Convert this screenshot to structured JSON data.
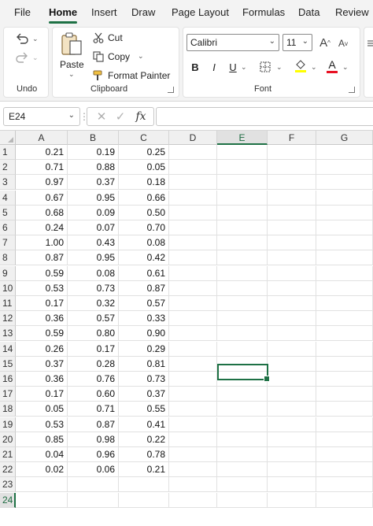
{
  "menu": {
    "items": [
      "File",
      "Home",
      "Insert",
      "Draw",
      "Page Layout",
      "Formulas",
      "Data",
      "Review"
    ],
    "active": "Home"
  },
  "ribbon": {
    "undo_group": "Undo",
    "clipboard_group": "Clipboard",
    "paste_label": "Paste",
    "cut_label": "Cut",
    "copy_label": "Copy",
    "format_painter_label": "Format Painter",
    "font_group": "Font",
    "font_name": "Calibri",
    "font_size": "11",
    "bold": "B",
    "italic": "I",
    "underline": "U",
    "grow_font": "A",
    "shrink_font": "A",
    "font_color_letter": "A",
    "fill_color": "#ffff00",
    "font_color": "#e81123"
  },
  "formula_bar": {
    "name_box": "E24",
    "fx": "fx",
    "value": ""
  },
  "sheet": {
    "columns": [
      "A",
      "B",
      "C",
      "D",
      "E",
      "F",
      "G"
    ],
    "selected_column": "E",
    "rows": [
      "1",
      "2",
      "3",
      "4",
      "5",
      "6",
      "7",
      "8",
      "9",
      "10",
      "11",
      "12",
      "13",
      "14",
      "15",
      "16",
      "17",
      "18",
      "19",
      "20",
      "21",
      "22",
      "23",
      "24"
    ],
    "selected_row": "24",
    "data": [
      [
        "0.21",
        "0.19",
        "0.25"
      ],
      [
        "0.71",
        "0.88",
        "0.05"
      ],
      [
        "0.97",
        "0.37",
        "0.18"
      ],
      [
        "0.67",
        "0.95",
        "0.66"
      ],
      [
        "0.68",
        "0.09",
        "0.50"
      ],
      [
        "0.24",
        "0.07",
        "0.70"
      ],
      [
        "1.00",
        "0.43",
        "0.08"
      ],
      [
        "0.87",
        "0.95",
        "0.42"
      ],
      [
        "0.59",
        "0.08",
        "0.61"
      ],
      [
        "0.53",
        "0.73",
        "0.87"
      ],
      [
        "0.17",
        "0.32",
        "0.57"
      ],
      [
        "0.36",
        "0.57",
        "0.33"
      ],
      [
        "0.59",
        "0.80",
        "0.90"
      ],
      [
        "0.26",
        "0.17",
        "0.29"
      ],
      [
        "0.37",
        "0.28",
        "0.81"
      ],
      [
        "0.36",
        "0.76",
        "0.73"
      ],
      [
        "0.17",
        "0.60",
        "0.37"
      ],
      [
        "0.05",
        "0.71",
        "0.55"
      ],
      [
        "0.53",
        "0.87",
        "0.41"
      ],
      [
        "0.85",
        "0.98",
        "0.22"
      ],
      [
        "0.04",
        "0.96",
        "0.78"
      ],
      [
        "0.02",
        "0.06",
        "0.21"
      ]
    ],
    "accent": "#1e7145"
  }
}
